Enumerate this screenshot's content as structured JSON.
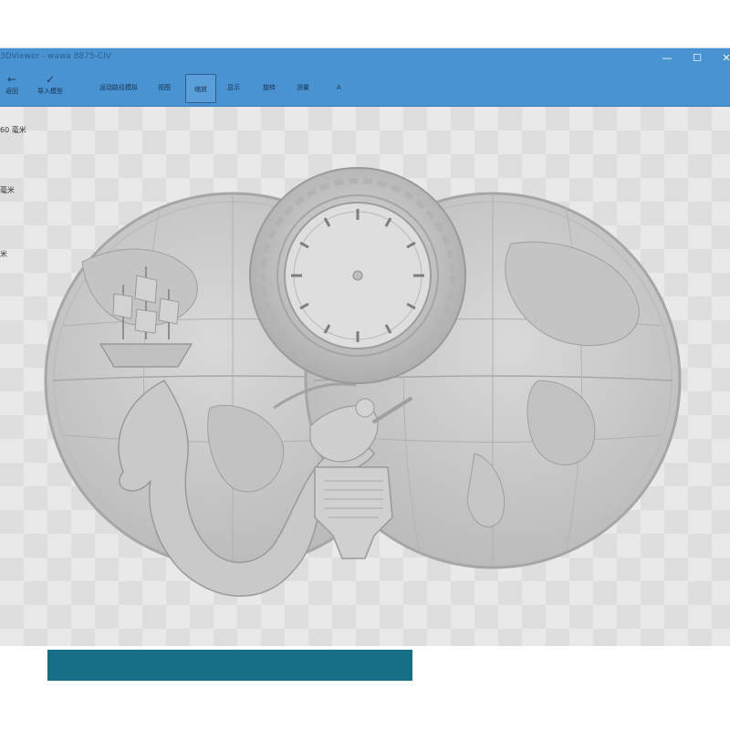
{
  "window": {
    "title": "3DViewer - wawa 8875-CIV",
    "controls": {
      "minimize": "—",
      "maximize": "☐",
      "close": "✕"
    }
  },
  "ribbon": {
    "items": [
      {
        "label": "返回",
        "icon": "←"
      },
      {
        "label": "导入模型",
        "icon": "✓"
      }
    ],
    "tools": [
      {
        "label": "运动路径模拟"
      },
      {
        "label": "视图"
      },
      {
        "label": "缩放"
      },
      {
        "label": "显示"
      },
      {
        "label": "旋转"
      },
      {
        "label": "测量"
      },
      {
        "label": "A"
      }
    ]
  },
  "dimensions": [
    {
      "label": "60 毫米"
    },
    {
      "label": "毫米"
    },
    {
      "label": "米"
    }
  ],
  "model": {
    "description": ""
  },
  "colors": {
    "accent": "#4a93d2",
    "bottom_bar": "#156f86",
    "relief": "#c8c8c8"
  }
}
